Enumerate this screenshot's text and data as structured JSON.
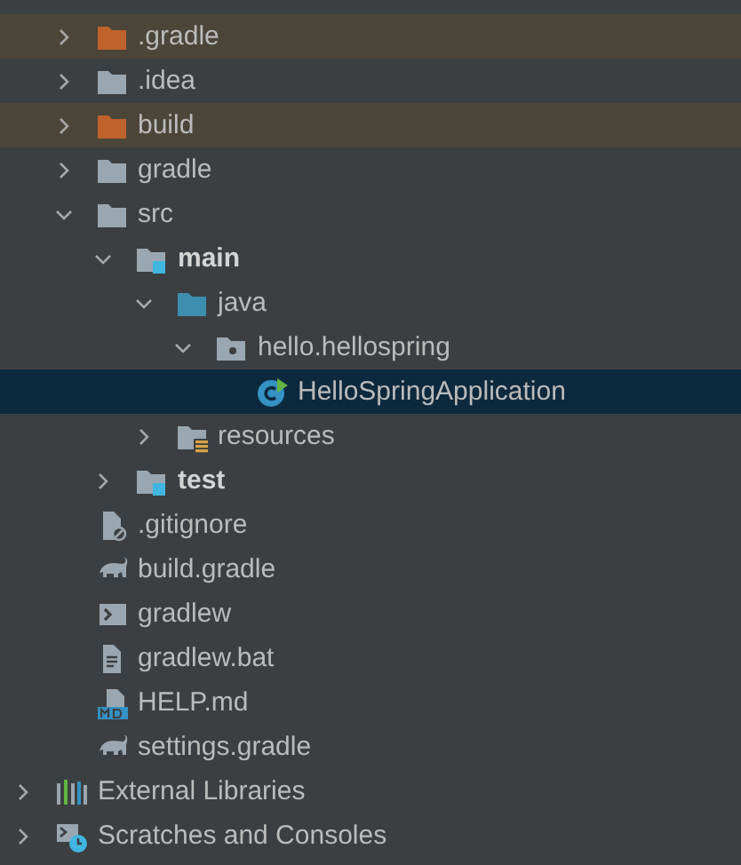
{
  "project_items": [
    {
      "label": ".gradle",
      "kind": "folder",
      "excluded": true,
      "expanded": false,
      "selected": false
    },
    {
      "label": ".idea",
      "kind": "folder",
      "excluded": false,
      "expanded": false,
      "selected": false
    },
    {
      "label": "build",
      "kind": "folder",
      "excluded": true,
      "expanded": false,
      "selected": false
    },
    {
      "label": "gradle",
      "kind": "folder",
      "excluded": false,
      "expanded": false,
      "selected": false
    },
    {
      "label": "src",
      "kind": "folder",
      "excluded": false,
      "expanded": true,
      "selected": false,
      "children": [
        {
          "label": "main",
          "kind": "module",
          "excluded": false,
          "expanded": true,
          "selected": false,
          "children": [
            {
              "label": "java",
              "kind": "source",
              "excluded": false,
              "expanded": true,
              "selected": false,
              "children": [
                {
                  "label": "hello.hellospring",
                  "kind": "package",
                  "excluded": false,
                  "expanded": true,
                  "selected": false,
                  "children": [
                    {
                      "label": "HelloSpringApplication",
                      "kind": "spring-class",
                      "selected": true
                    }
                  ]
                }
              ]
            },
            {
              "label": "resources",
              "kind": "resources",
              "excluded": false,
              "expanded": false,
              "selected": false
            }
          ]
        },
        {
          "label": "test",
          "kind": "module",
          "excluded": false,
          "expanded": false,
          "selected": false
        }
      ]
    },
    {
      "label": ".gitignore",
      "kind": "ignore-file",
      "excluded": false,
      "selected": false
    },
    {
      "label": "build.gradle",
      "kind": "gradle",
      "excluded": false,
      "selected": false
    },
    {
      "label": "gradlew",
      "kind": "shell",
      "excluded": false,
      "selected": false
    },
    {
      "label": "gradlew.bat",
      "kind": "text-file",
      "excluded": false,
      "selected": false
    },
    {
      "label": "HELP.md",
      "kind": "markdown",
      "excluded": false,
      "selected": false
    },
    {
      "label": "settings.gradle",
      "kind": "gradle",
      "excluded": false,
      "selected": false
    }
  ],
  "other_items": [
    {
      "label": "External Libraries",
      "kind": "libraries",
      "excluded": false,
      "expanded": false,
      "selected": false
    },
    {
      "label": "Scratches and Consoles",
      "kind": "scratches",
      "excluded": false,
      "expanded": false,
      "selected": false
    }
  ]
}
